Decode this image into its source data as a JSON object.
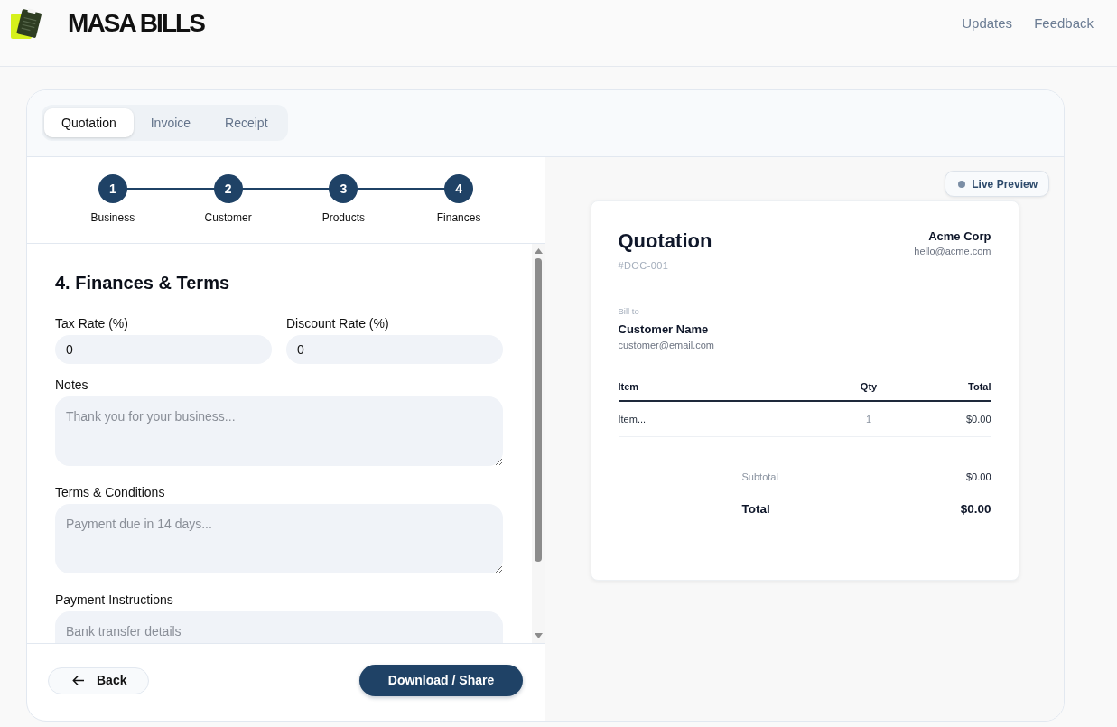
{
  "header": {
    "title": "MASA BILLS",
    "links": [
      "Updates",
      "Feedback"
    ]
  },
  "doc_tabs": [
    {
      "label": "Quotation",
      "selected": true
    },
    {
      "label": "Invoice",
      "selected": false
    },
    {
      "label": "Receipt",
      "selected": false
    }
  ],
  "stepper": [
    {
      "number": "1",
      "label": "Business",
      "reached": true
    },
    {
      "number": "2",
      "label": "Customer",
      "reached": true
    },
    {
      "number": "3",
      "label": "Products",
      "reached": true
    },
    {
      "number": "4",
      "label": "Finances",
      "reached": true
    }
  ],
  "form": {
    "heading": "4. Finances & Terms",
    "fields": [
      {
        "kind": "input",
        "label": "Tax Rate (%)",
        "value": "0"
      },
      {
        "kind": "input",
        "label": "Discount Rate (%)",
        "value": "0"
      },
      {
        "kind": "textarea",
        "label": "Notes",
        "placeholder": "Thank you for your business..."
      },
      {
        "kind": "textarea",
        "label": "Terms & Conditions",
        "placeholder": "Payment due in 14 days..."
      },
      {
        "kind": "textarea",
        "label": "Payment Instructions",
        "placeholder": "Bank transfer details"
      }
    ]
  },
  "footer": {
    "back": "Back",
    "submit": "Download / Share"
  },
  "preview": {
    "badge": "Live Preview",
    "document": {
      "title": "Quotation",
      "number": "#DOC-001",
      "company": "Acme Corp",
      "company_email": "hello@acme.com",
      "bill_to_label": "Bill to",
      "customer_name": "Customer Name",
      "customer_email": "customer@email.com",
      "table": {
        "columns": [
          "Item",
          "Qty",
          "Total"
        ],
        "rows": [
          [
            "Item...",
            "1",
            "$0.00"
          ]
        ]
      },
      "totals": [
        {
          "kind": "subtotal",
          "label": "Subtotal",
          "value": "$0.00"
        },
        {
          "kind": "total",
          "label": "Total",
          "value": "$0.00"
        }
      ]
    }
  }
}
